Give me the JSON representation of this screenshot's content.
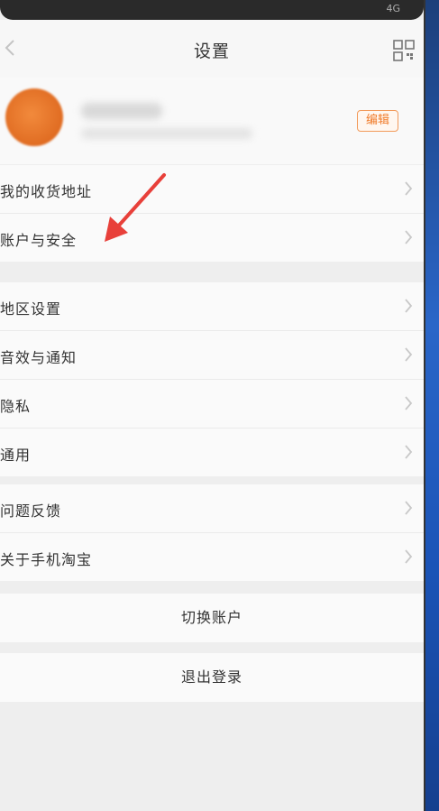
{
  "status_bar": {
    "right_text": "4G"
  },
  "header": {
    "title": "设置"
  },
  "profile": {
    "edit_label": "编辑"
  },
  "groups": [
    {
      "items": [
        {
          "label": "我的收货地址"
        },
        {
          "label": "账户与安全"
        }
      ]
    },
    {
      "items": [
        {
          "label": "地区设置"
        },
        {
          "label": "音效与通知"
        },
        {
          "label": "隐私"
        },
        {
          "label": "通用"
        }
      ]
    },
    {
      "items": [
        {
          "label": "问题反馈"
        },
        {
          "label": "关于手机淘宝"
        }
      ]
    }
  ],
  "actions": {
    "switch_account": "切换账户",
    "logout": "退出登录"
  },
  "colors": {
    "accent": "#f07a28",
    "annotation_arrow": "#e8403a",
    "background": "#eeeeee"
  }
}
